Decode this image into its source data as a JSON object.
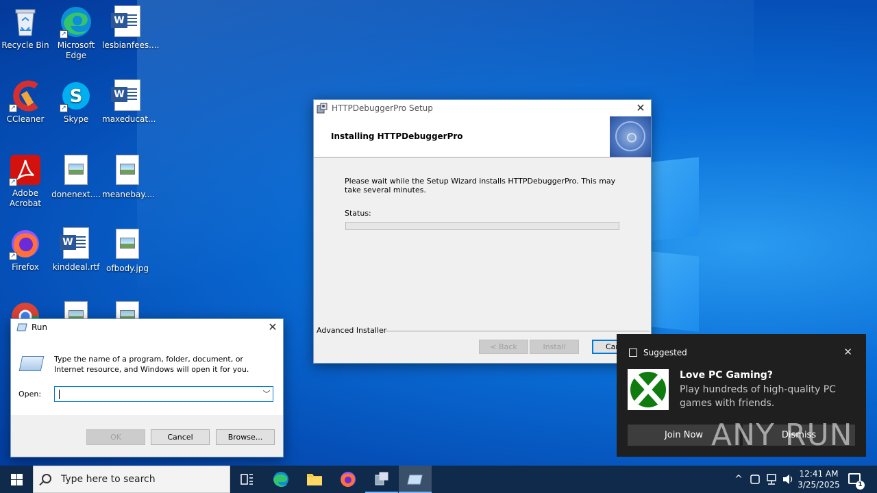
{
  "desktop": {
    "icons": [
      {
        "label": "Recycle Bin"
      },
      {
        "label": "Microsoft Edge"
      },
      {
        "label": "lesbianfees...."
      },
      {
        "label": "CCleaner"
      },
      {
        "label": "Skype"
      },
      {
        "label": "maxeducat..."
      },
      {
        "label": "Adobe Acrobat"
      },
      {
        "label": "donenext...."
      },
      {
        "label": "meanebay...."
      },
      {
        "label": "Firefox"
      },
      {
        "label": "kinddeal.rtf"
      },
      {
        "label": "ofbody.jpg"
      }
    ]
  },
  "setup": {
    "title": "HTTPDebuggerPro Setup",
    "close_glyph": "✕",
    "header": "Installing HTTPDebuggerPro",
    "message": "Please wait while the Setup Wizard installs HTTPDebuggerPro.  This may take several minutes.",
    "status_label": "Status:",
    "progress_fraction": 0,
    "brand": "Advanced Installer",
    "back_label": "< Back",
    "install_label": "Install",
    "cancel_label": "Can"
  },
  "run": {
    "title": "Run",
    "close_glyph": "✕",
    "description": "Type the name of a program, folder, document, or Internet resource, and Windows will open it for you.",
    "open_label": "Open:",
    "input_value": "",
    "ok_label": "OK",
    "cancel_label": "Cancel",
    "browse_label": "Browse..."
  },
  "toast": {
    "header": "Suggested",
    "close_glyph": "✕",
    "title": "Love PC Gaming?",
    "body": "Play hundreds of high-quality PC games with friends.",
    "join_label": "Join Now",
    "dismiss_label": "Dismiss"
  },
  "watermark": "ANY RUN",
  "taskbar": {
    "search_placeholder": "Type here to search",
    "time": "12:41 AM",
    "date": "3/25/2025",
    "notification_count": "1"
  },
  "colors": {
    "accent": "#0078d7",
    "xbox_green": "#107c10",
    "taskbar": "#0f2a4a"
  }
}
